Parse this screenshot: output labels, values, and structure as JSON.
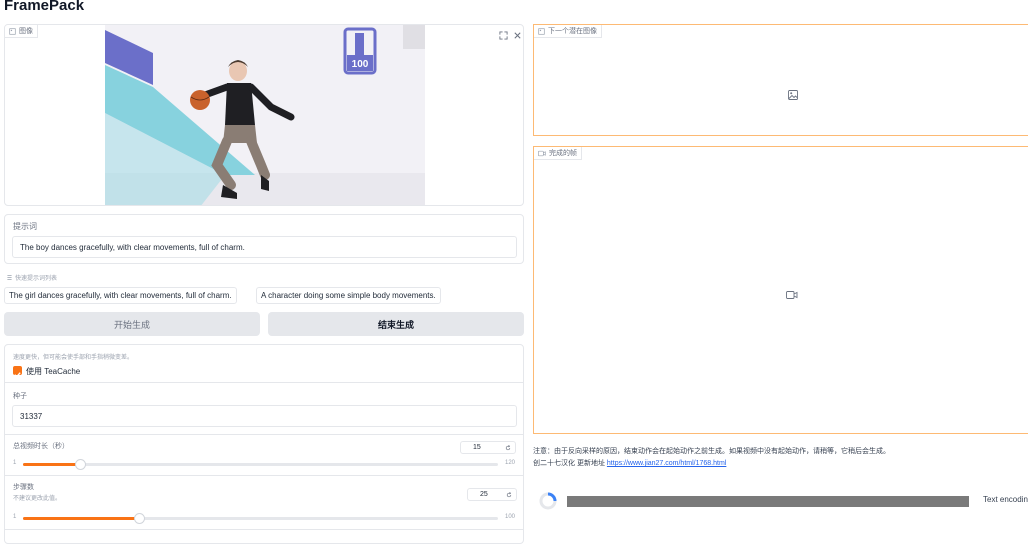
{
  "app_title": "FramePack",
  "image_input": {
    "label": "图像",
    "photo": {
      "badge_text": "100"
    }
  },
  "prompt": {
    "label": "提示词",
    "value": "The boy dances gracefully, with clear movements, full of charm."
  },
  "quick_prompts": {
    "label": "快速提示词列表",
    "items": [
      "The girl dances gracefully, with clear movements, full of charm.",
      "A character doing some simple body movements."
    ]
  },
  "buttons": {
    "start": "开始生成",
    "end": "结束生成"
  },
  "teacache": {
    "hint": "速度更快，但可能会使手部和手指稍微变差。",
    "label": "使用 TeaCache",
    "checked": true
  },
  "seed": {
    "label": "种子",
    "value": "31337"
  },
  "video_length": {
    "label": "总视频时长（秒）",
    "value": "15",
    "min": "1",
    "max": "120",
    "fraction": 0.118
  },
  "steps": {
    "label": "步骤数",
    "hint": "不建议更改此值。",
    "value": "25",
    "min": "1",
    "max": "100",
    "fraction": 0.242
  },
  "next_latents": {
    "label": "下一个潜在图像"
  },
  "finished_frames": {
    "label": "完成的帧"
  },
  "note": {
    "text": "注意：由于反向采样的原因，结束动作会在起始动作之前生成。如果视频中没有起始动作，请稍等，它稍后会生成。",
    "credit": "创二十七汉化 更新地址",
    "link": "https://www.jian27.com/html/1768.html"
  },
  "progress": {
    "text": "Text encoding"
  },
  "colors": {
    "accent": "#f97316",
    "link": "#2563eb"
  }
}
